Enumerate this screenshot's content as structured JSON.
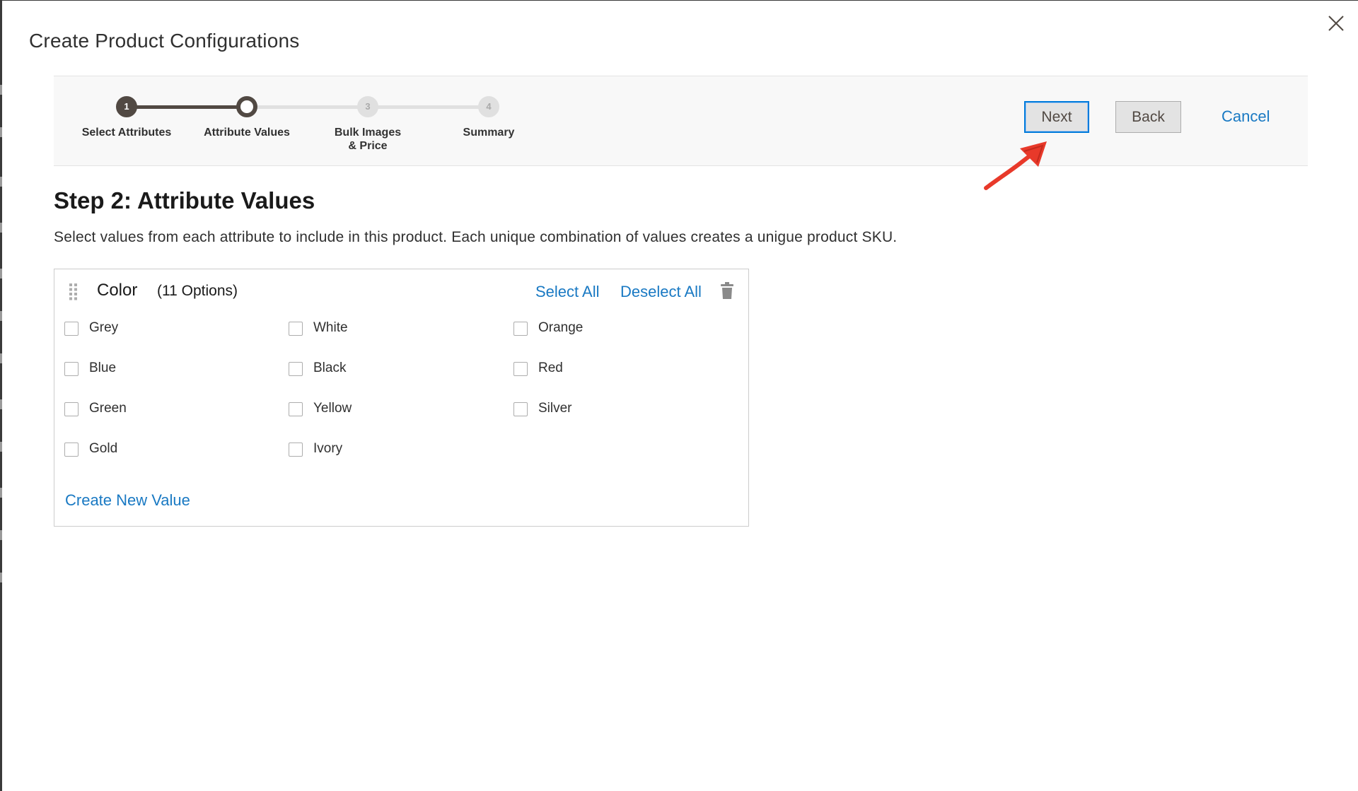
{
  "modal": {
    "title": "Create Product Configurations",
    "close_icon": "close-icon"
  },
  "wizard": {
    "steps": [
      {
        "number": "1",
        "label": "Select Attributes",
        "state": "done"
      },
      {
        "number": "",
        "label": "Attribute Values",
        "state": "active"
      },
      {
        "number": "3",
        "label": "Bulk Images & Price",
        "state": "todo"
      },
      {
        "number": "4",
        "label": "Summary",
        "state": "todo"
      }
    ],
    "next_label": "Next",
    "back_label": "Back",
    "cancel_label": "Cancel"
  },
  "step": {
    "heading": "Step 2: Attribute Values",
    "description": "Select values from each attribute to include in this product. Each unique combination of values creates a unigue product SKU."
  },
  "attribute": {
    "name": "Color",
    "count_label": "(11 Options)",
    "select_all_label": "Select All",
    "deselect_all_label": "Deselect All",
    "options": [
      "Grey",
      "White",
      "Orange",
      "Blue",
      "Black",
      "Red",
      "Green",
      "Yellow",
      "Silver",
      "Gold",
      "Ivory"
    ],
    "create_new_label": "Create New Value"
  },
  "colors": {
    "accent": "#1979c3",
    "annotation_arrow": "#e8392a",
    "step_done": "#514943"
  }
}
